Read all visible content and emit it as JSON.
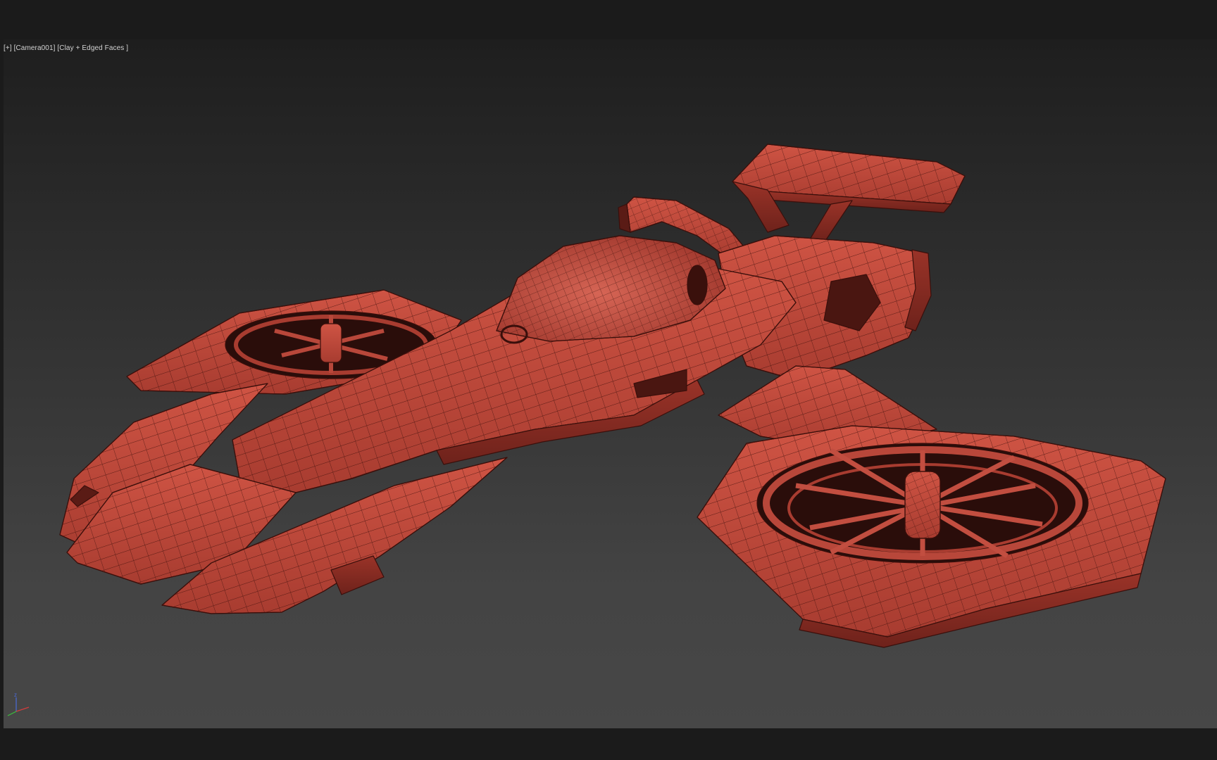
{
  "viewport": {
    "label_plus": "[+]",
    "label_camera": "[Camera001]",
    "label_shading": "[Clay + Edged Faces ]",
    "axis_z": "z"
  },
  "colors": {
    "background": "#1b1b1b",
    "viewport_top": "#1e1e1e",
    "viewport_bottom": "#474747",
    "clay": "#c34a3c",
    "clay_dark": "#8e2d24",
    "wire": "#3a0f0b",
    "axis_x": "#d23c3c",
    "axis_y": "#3cbf3c",
    "axis_z": "#4a6ad8"
  },
  "model": {
    "name_icon": "hover-vehicle-model",
    "shading": "clay-edged-faces"
  }
}
